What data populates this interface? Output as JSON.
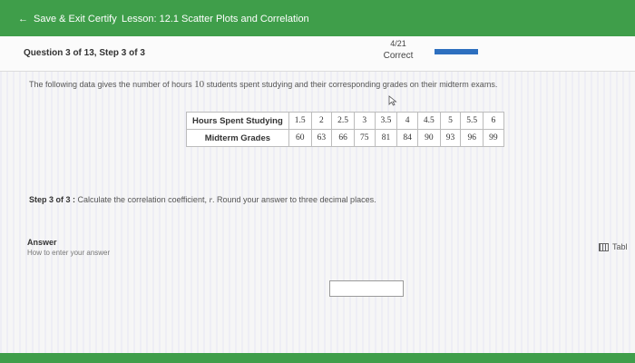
{
  "topbar": {
    "back_label": "Save & Exit Certify",
    "lesson": "Lesson: 12.1 Scatter Plots and Correlation"
  },
  "question": {
    "number": "Question 3 of 13, Step 3 of 3",
    "score": "4/21",
    "status": "Correct",
    "progress_fraction": 1.0
  },
  "problem": {
    "prompt_before": "The following data gives the number of hours",
    "count": "10",
    "prompt_after": "students spent studying and their corresponding grades on their midterm exams.",
    "table": {
      "row_headers": [
        "Hours Spent Studying",
        "Midterm Grades"
      ],
      "hours": [
        "1.5",
        "2",
        "2.5",
        "3",
        "3.5",
        "4",
        "4.5",
        "5",
        "5.5",
        "6"
      ],
      "grades": [
        "60",
        "63",
        "66",
        "75",
        "81",
        "84",
        "90",
        "93",
        "96",
        "99"
      ]
    }
  },
  "step": {
    "label": "Step 3 of 3 :",
    "text_before": "Calculate the correlation coefficient,",
    "variable": "r",
    "text_after": ". Round your answer to three decimal places."
  },
  "answer": {
    "label": "Answer",
    "help_link": "How to enter your answer",
    "value": ""
  },
  "tables_button": {
    "label": "Tabl",
    "icon": "table-icon"
  },
  "colors": {
    "top_bar": "#3f9e4a",
    "progress": "#2d6fbf"
  }
}
